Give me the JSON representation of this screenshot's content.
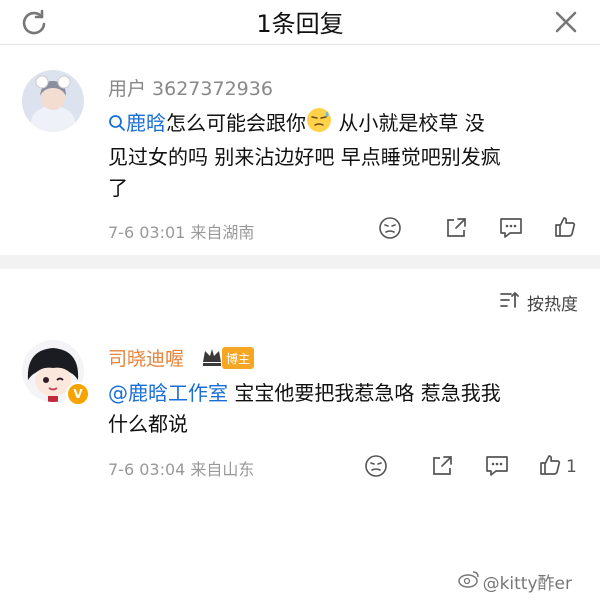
{
  "header": {
    "title": "1条回复"
  },
  "comment1": {
    "username": "用户 3627372936",
    "mention": "鹿晗",
    "text_a": "怎么可能会跟你",
    "text_b": " 从小就是校草 没",
    "text_line2": "见过女的吗 别来沾边好吧 早点睡觉吧别发疯",
    "text_line3": "了",
    "meta": "7-6 03:01  来自湖南"
  },
  "sort": {
    "label": "按热度"
  },
  "comment2": {
    "username": "司晓迪喔",
    "badge": "博主",
    "mention": "@鹿晗工作室",
    "text_a": " 宝宝他要把我惹急咯 惹急我我",
    "text_line2": "什么都说",
    "meta": "7-6 03:04  来自山东",
    "like_count": "1"
  },
  "watermark": {
    "text": "@kitty酢er"
  },
  "colors": {
    "link": "#1a6fd6",
    "name_vip": "#e8833a",
    "badge": "#f5a623"
  }
}
